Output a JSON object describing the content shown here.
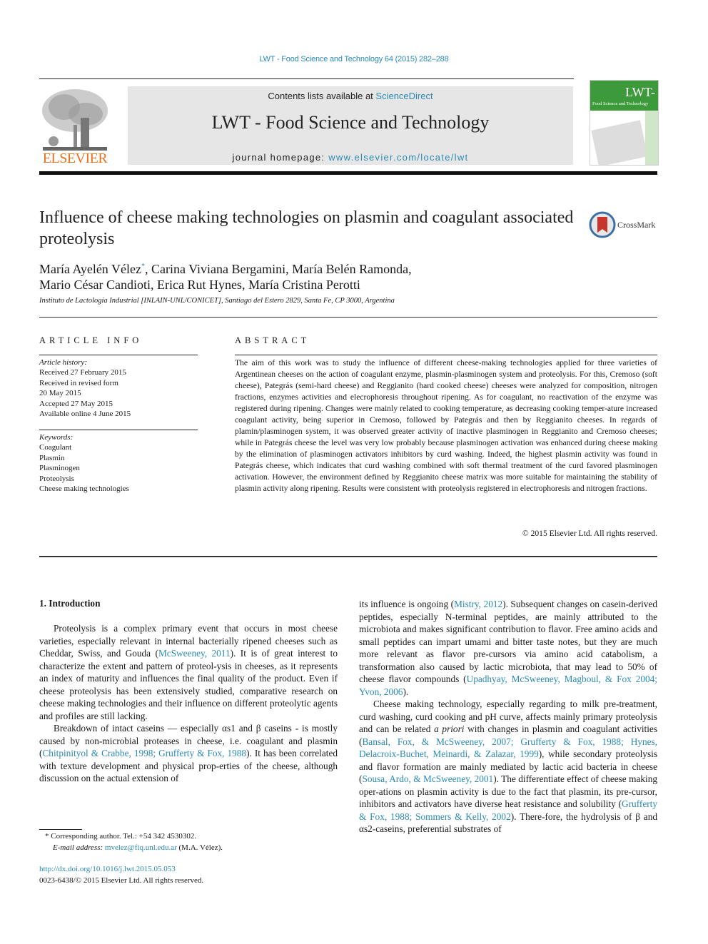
{
  "running_head": "LWT - Food Science and Technology 64 (2015) 282–288",
  "header": {
    "contents_prefix": "Contents lists available at ",
    "contents_link": "ScienceDirect",
    "journal_title": "LWT - Food Science and Technology",
    "homepage_prefix": "journal homepage: ",
    "homepage_link": "www.elsevier.com/locate/lwt",
    "publisher_logo_text": "ELSEVIER",
    "cover_title": "LWT-",
    "cover_subtitle": "Food Science and Technology"
  },
  "article": {
    "title": "Influence of cheese making technologies on plasmin and coagulant associated proteolysis",
    "crossmark_label": "CrossMark",
    "authors_line1": "María Ayelén Vélez",
    "authors_line1_mark": "*",
    "authors_line1_rest": ", Carina Viviana Bergamini, María Belén Ramonda,",
    "authors_line2": "Mario César Candioti, Erica Rut Hynes, María Cristina Perotti",
    "affiliation": "Instituto de Lactología Industrial [INLAIN-UNL/CONICET], Santiago del Estero 2829, Santa Fe, CP 3000, Argentina"
  },
  "article_info": {
    "heading": "ARTICLE INFO",
    "history_label": "Article history:",
    "history": [
      "Received 27 February 2015",
      "Received in revised form",
      "20 May 2015",
      "Accepted 27 May 2015",
      "Available online 4 June 2015"
    ],
    "keywords_label": "Keywords:",
    "keywords": [
      "Coagulant",
      "Plasmin",
      "Plasminogen",
      "Proteolysis",
      "Cheese making technologies"
    ]
  },
  "abstract": {
    "heading": "ABSTRACT",
    "text": "The aim of this work was to study the influence of different cheese-making technologies applied for three varieties of Argentinean cheeses on the action of coagulant enzyme, plasmin-plasminogen system and proteolysis. For this, Cremoso (soft cheese), Pategrás (semi-hard cheese) and Reggianito (hard cooked cheese) cheeses were analyzed for composition, nitrogen fractions, enzymes activities and elecrophoresis throughout ripening. As for coagulant, no reactivation of the enzyme was registered during ripening. Changes were mainly related to cooking temperature, as decreasing cooking temper-ature increased coagulant activity, being superior in Cremoso, followed by Pategrás and then by Reggianito cheeses. In regards of plamin/plasminogen system, it was observed greater activity of inactive plasminogen in Reggianito and Cremoso cheeses; while in Pategrás cheese the level was very low probably because plasminogen activation was enhanced during cheese making by the elimination of plasminogen activators inhibitors by curd washing. Indeed, the highest plasmin activity was found in Pategrás cheese, which indicates that curd washing combined with soft thermal treatment of the curd favored plasminogen activation. However, the environment defined by Reggianito cheese matrix was more suitable for maintaining the stability of plasmin activity along ripening. Results were consistent with proteolysis registered in electrophoresis and nitrogen fractions.",
    "copyright": "© 2015 Elsevier Ltd. All rights reserved."
  },
  "body": {
    "intro_heading": "1.  Introduction",
    "p1_a": "Proteolysis is a complex primary event that occurs in most cheese varieties, especially relevant in internal bacterially ripened cheeses such as Cheddar, Swiss, and Gouda (",
    "p1_ref": "McSweeney, 2011",
    "p1_b": "). It is of great interest to characterize the extent and pattern of proteol-ysis in cheeses, as it represents an index of maturity and influences the final quality of the product. Even if cheese proteolysis has been extensively studied, comparative research on cheese making technologies and their influence on different proteolytic agents and profiles are still lacking.",
    "p2_a": "Breakdown of intact caseins — especially αs1 and β caseins - is mostly caused by non-microbial proteases in cheese, i.e. coagulant and plasmin (",
    "p2_ref": "Chitpinityol & Crabbe, 1998; Grufferty & Fox, 1988",
    "p2_b": "). It has been correlated with texture development and physical prop-erties of the cheese, although discussion on the actual extension of",
    "p3_a": "its influence is ongoing (",
    "p3_ref": "Mistry, 2012",
    "p3_b": "). Subsequent changes on casein-derived peptides, especially N-terminal peptides, are mainly attributed to the microbiota and makes significant contribution to flavor. Free amino acids and small peptides can impart umami and bitter taste notes, but they are much more relevant as flavor pre-cursors via amino acid catabolism, a transformation also caused by lactic microbiota, that may lead to 50% of cheese flavor compounds (",
    "p3_ref2": "Upadhyay, McSweeney, Magboul, & Fox 2004; Yvon, 2006",
    "p3_c": ").",
    "p4_a": "Cheese making technology, especially regarding to milk pre-treatment, curd washing, curd cooking and pH curve, affects mainly primary proteolysis and can be related ",
    "p4_it": "a priori",
    "p4_b": " with changes in plasmin and coagulant activities (",
    "p4_ref": "Bansal, Fox, & McSweeney, 2007; Grufferty & Fox, 1988; Hynes, Delacroix-Buchet, Meinardi, & Zalazar, 1999",
    "p4_c": "), while secondary proteolysis and flavor formation are mainly mediated by lactic acid bacteria in cheese (",
    "p4_ref2": "Sousa, Ardo, & McSweeney, 2001",
    "p4_d": "). The differentiate effect of cheese making oper-ations on plasmin activity is due to the fact that plasmin, its pre-cursor, inhibitors and activators have diverse heat resistance and solubility (",
    "p4_ref3": "Grufferty & Fox, 1988; Sommers & Kelly, 2002",
    "p4_e": "). There-fore, the hydrolysis of β and αs2-caseins, preferential substrates of"
  },
  "footnote": {
    "mark": "*",
    "corresponding": " Corresponding author. Tel.: +54 342 4530302.",
    "email_label": "E-mail address: ",
    "email": "mvelez@fiq.unl.edu.ar",
    "email_suffix": " (M.A. Vélez)."
  },
  "doi": {
    "link": "http://dx.doi.org/10.1016/j.lwt.2015.05.053",
    "issn": "0023-6438/© 2015 Elsevier Ltd. All rights reserved."
  }
}
